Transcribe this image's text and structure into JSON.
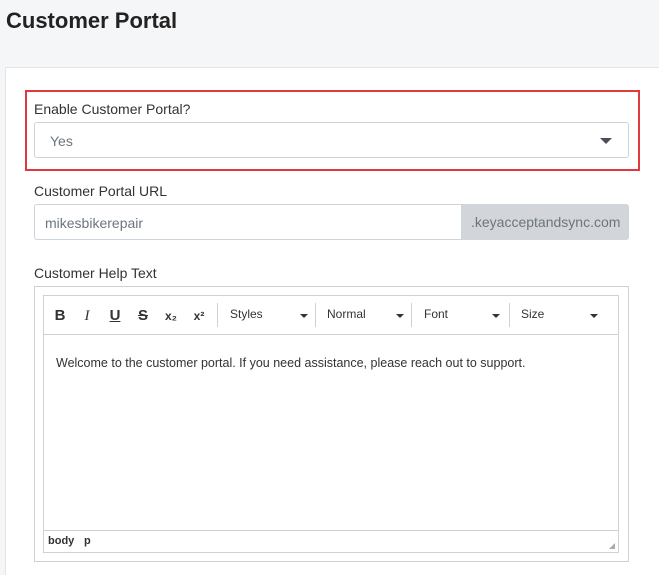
{
  "page": {
    "title": "Customer Portal"
  },
  "enable_portal": {
    "label": "Enable Customer Portal?",
    "value": "Yes"
  },
  "portal_url": {
    "label": "Customer Portal URL",
    "value": "mikesbikerepair",
    "suffix": ".keyacceptandsync.com"
  },
  "help_text": {
    "label": "Customer Help Text",
    "toolbar": {
      "bold": "B",
      "italic": "I",
      "underline": "U",
      "strike": "S",
      "subscript": "x₂",
      "superscript": "x²",
      "styles": "Styles",
      "format": "Normal",
      "font": "Font",
      "size": "Size"
    },
    "content": "Welcome to the customer portal. If you need assistance, please reach out to support.",
    "path": [
      "body",
      "p"
    ]
  },
  "colors": {
    "highlight_border": "#e0393e",
    "suffix_bg": "#d2d6db"
  }
}
